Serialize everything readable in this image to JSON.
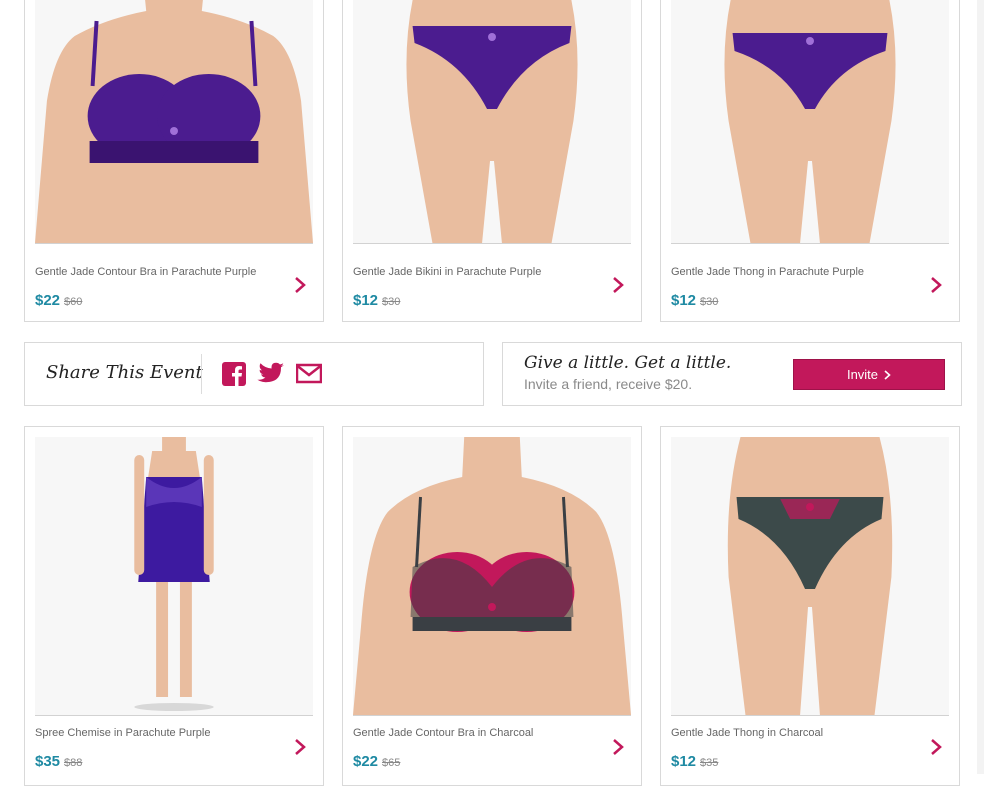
{
  "products": [
    {
      "name": "Gentle Jade Contour Bra in Parachute Purple",
      "price": "$22",
      "original_price": "$60",
      "image": "bra",
      "color": "#4b1c8f"
    },
    {
      "name": "Gentle Jade Bikini in Parachute Purple",
      "price": "$12",
      "original_price": "$30",
      "image": "bikini",
      "color": "#4b1c8f"
    },
    {
      "name": "Gentle Jade Thong in Parachute Purple",
      "price": "$12",
      "original_price": "$30",
      "image": "thong",
      "color": "#4b1c8f"
    },
    {
      "name": "Spree Chemise in Parachute Purple",
      "price": "$35",
      "original_price": "$88",
      "image": "chemise",
      "color": "#3d1aa0"
    },
    {
      "name": "Gentle Jade Contour Bra in Charcoal",
      "price": "$22",
      "original_price": "$65",
      "image": "bra",
      "color": "#3a3f44"
    },
    {
      "name": "Gentle Jade Thong in Charcoal",
      "price": "$12",
      "original_price": "$35",
      "image": "thong",
      "color": "#3c4a4a"
    }
  ],
  "share": {
    "title": "Share This Event",
    "icons": [
      "facebook-icon",
      "twitter-icon",
      "mail-icon"
    ]
  },
  "invite": {
    "headline": "Give a little. Get a little.",
    "subtext": "Invite a friend, receive $20.",
    "button_label": "Invite"
  },
  "colors": {
    "accent": "#c2185b",
    "price": "#1f8aa3",
    "border": "#d9d9d9"
  }
}
